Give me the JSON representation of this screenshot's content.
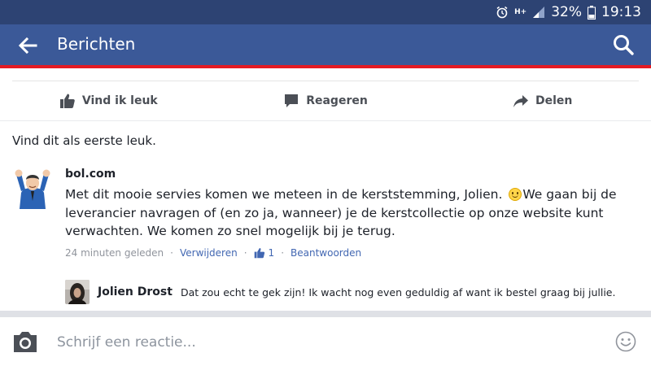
{
  "status_bar": {
    "battery_percent": "32%",
    "time": "19:13",
    "network_label": "H+"
  },
  "header": {
    "title": "Berichten"
  },
  "actions": {
    "like_label": "Vind ik leuk",
    "comment_label": "Reageren",
    "share_label": "Delen"
  },
  "likes_summary": "Vind dit als eerste leuk.",
  "comment": {
    "author": "bol.com",
    "text_part1": "Met dit mooie servies komen we meteen in de kerststemming, Jolien.",
    "text_part2": "We gaan bij de leverancier navragen of (en zo ja, wanneer) je de kerstcollectie op onze website kunt verwachten. We komen zo snel mogelijk bij je terug.",
    "time": "24 minuten geleden",
    "delete_label": "Verwijderen",
    "like_count": "1",
    "reply_label": "Beantwoorden",
    "separator": "·"
  },
  "reply": {
    "author": "Jolien Drost",
    "text": "Dat zou echt te gek zijn! Ik wacht nog even geduldig af want ik bestel graag bij jullie."
  },
  "composer": {
    "placeholder": "Schrijf een reactie..."
  },
  "colors": {
    "status_bar": "#2d4373",
    "app_bar": "#3b5998",
    "accent_line": "#e41b23",
    "link": "#4267b2"
  }
}
